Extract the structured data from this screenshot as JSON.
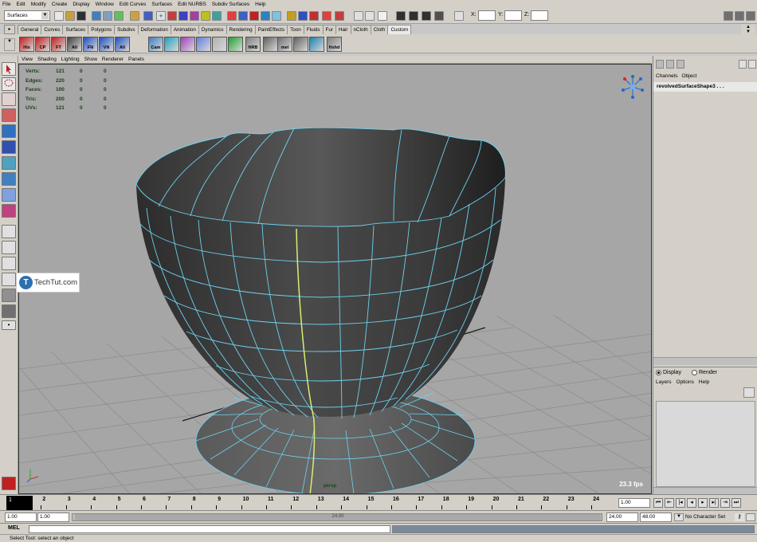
{
  "menubar": {
    "items": [
      "File",
      "Edit",
      "Modify",
      "Create",
      "Display",
      "Window",
      "Edit Curves",
      "Surfaces",
      "Edit NURBS",
      "Subdiv Surfaces",
      "Help"
    ]
  },
  "status_line": {
    "menu_set": "Surfaces",
    "x_label": "X:",
    "y_label": "Y:",
    "z_label": "Z:"
  },
  "shelf": {
    "tabs": [
      "General",
      "Curves",
      "Surfaces",
      "Polygons",
      "Subdivs",
      "Deformation",
      "Animation",
      "Dynamics",
      "Rendering",
      "PaintEffects",
      "Toon",
      "Fluids",
      "Fur",
      "Hair",
      "nCloth",
      "Cloth",
      "Custom"
    ],
    "active_tab": "Custom",
    "buttons": [
      {
        "label": "His",
        "color": "#c02020",
        "icon": "arrow-icon"
      },
      {
        "label": "CP",
        "color": "#c02020",
        "icon": "arrow-icon"
      },
      {
        "label": "FT",
        "color": "#c02020",
        "icon": "arrow-icon"
      },
      {
        "label": "All",
        "color": "#404040",
        "icon": "arrow-icon"
      },
      {
        "label": "FN",
        "color": "#2050c0",
        "icon": "arrow-icon"
      },
      {
        "label": "VN",
        "color": "#2050c0",
        "icon": "arrow-icon"
      },
      {
        "label": "All",
        "color": "#2050c0",
        "icon": "arrow-icon"
      },
      {
        "label": "Cam",
        "color": "#4080c0",
        "icon": "camera-icon"
      },
      {
        "label": "",
        "color": "#20a0c0",
        "icon": "cube-icon"
      },
      {
        "label": "",
        "color": "#a040c0",
        "icon": "sphere-icon"
      },
      {
        "label": "",
        "color": "#6080e0",
        "icon": "sphere-icon"
      },
      {
        "label": "",
        "color": "#b0b0b0",
        "icon": "grid-icon"
      },
      {
        "label": "",
        "color": "#20a030",
        "icon": "play-icon"
      },
      {
        "label": "HRB",
        "color": "#808080",
        "icon": "window-icon"
      },
      {
        "label": "",
        "color": "#606060",
        "icon": "cross-icon"
      },
      {
        "label": "mel",
        "color": "#707070",
        "icon": "script-icon"
      },
      {
        "label": "",
        "color": "#606060",
        "icon": "joint-icon"
      },
      {
        "label": "",
        "color": "#2080b0",
        "icon": "down-arrow-icon"
      },
      {
        "label": "Hshd",
        "color": "#808080",
        "icon": "window-icon"
      }
    ]
  },
  "viewport": {
    "menu": [
      "View",
      "Shading",
      "Lighting",
      "Show",
      "Renderer",
      "Panels"
    ],
    "hud": [
      {
        "label": "Verts:",
        "a": "121",
        "b": "0",
        "c": "0"
      },
      {
        "label": "Edges:",
        "a": "220",
        "b": "0",
        "c": "0"
      },
      {
        "label": "Faces:",
        "a": "100",
        "b": "0",
        "c": "0"
      },
      {
        "label": "Tris:",
        "a": "200",
        "b": "0",
        "c": "0"
      },
      {
        "label": "UVs:",
        "a": "121",
        "b": "0",
        "c": "0"
      }
    ],
    "fps": "23.3 fps",
    "camera": "persp",
    "watermark": "TechTut.com",
    "watermark_logo": "T"
  },
  "channel_box": {
    "menu": [
      "Channels",
      "Object"
    ],
    "object_name": "revolvedSurfaceShape3 . . ."
  },
  "layer_editor": {
    "display_label": "Display",
    "render_label": "Render",
    "menu": [
      "Layers",
      "Options",
      "Help"
    ],
    "mode": "Display"
  },
  "time_slider": {
    "ticks": [
      "1",
      "2",
      "3",
      "4",
      "5",
      "6",
      "7",
      "8",
      "9",
      "10",
      "11",
      "12",
      "13",
      "14",
      "15",
      "16",
      "17",
      "18",
      "19",
      "20",
      "21",
      "22",
      "23",
      "24"
    ],
    "current_frame": "1",
    "current_frame_field": "1.00"
  },
  "range_slider": {
    "start_time": "1.00",
    "playback_start": "1.00",
    "range_label": "24.00",
    "playback_end": "24.00",
    "end_time": "48.00",
    "character_set": "No Character Set"
  },
  "command_line": {
    "label": "MEL"
  },
  "help_line": {
    "text": "Select Tool: select an object"
  }
}
